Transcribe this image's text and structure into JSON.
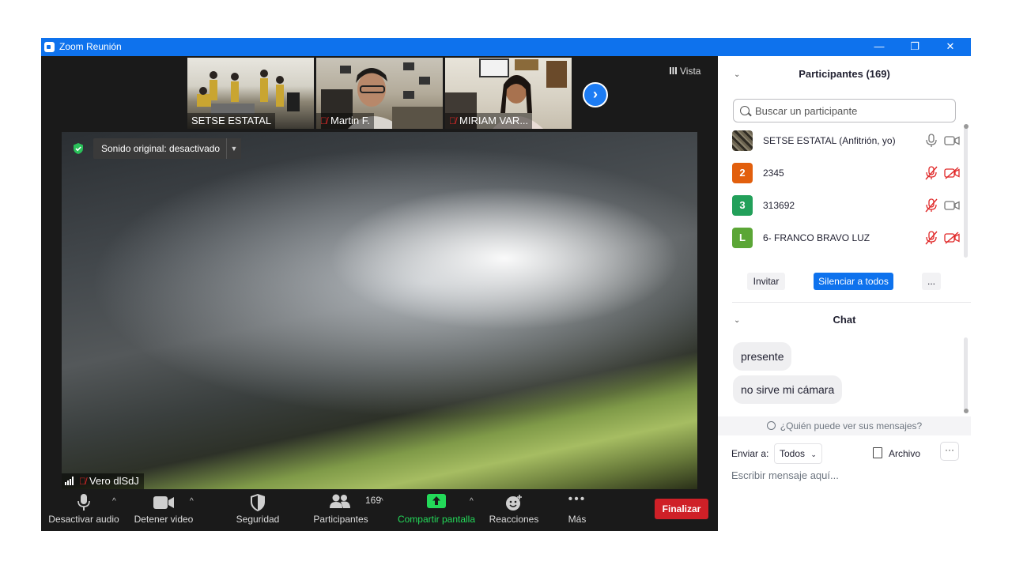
{
  "window": {
    "title": "Zoom Reunión",
    "controls": [
      "—",
      "❐",
      "✕"
    ]
  },
  "thumbnails": [
    {
      "name": "SETSE ESTATAL",
      "muted": false
    },
    {
      "name": "Martin F.",
      "muted": true
    },
    {
      "name": "MIRIAM VAR...",
      "muted": true
    }
  ],
  "view_button": "Vista",
  "main_video": {
    "original_sound": "Sonido original: desactivado",
    "speaker_label": "Vero dlSdJ",
    "speaker_muted": true
  },
  "toolbar": {
    "mute_audio": "Desactivar audio",
    "stop_video": "Detener video",
    "security": "Seguridad",
    "participants": "Participantes",
    "participants_count": "169",
    "share_screen": "Compartir pantalla",
    "reactions": "Reacciones",
    "more": "Más",
    "end": "Finalizar"
  },
  "participants_panel": {
    "title": "Participantes (169)",
    "search_placeholder": "Buscar un participante",
    "participants": [
      {
        "avatar": "",
        "name": "SETSE ESTATAL (Anfitrión, yo)",
        "avatar_color": "photo",
        "muted": false,
        "video_off": false
      },
      {
        "avatar": "2",
        "name": "2345",
        "avatar_color": "#e25f0d",
        "muted": true,
        "video_off": true
      },
      {
        "avatar": "3",
        "name": "313692",
        "avatar_color": "#22a05a",
        "muted": true,
        "video_off": false
      },
      {
        "avatar": "L",
        "name": "6- FRANCO BRAVO LUZ",
        "avatar_color": "#5ba636",
        "muted": true,
        "video_off": true
      }
    ],
    "invite": "Invitar",
    "mute_all": "Silenciar a todos",
    "more": "..."
  },
  "chat_panel": {
    "title": "Chat",
    "messages": [
      "presente",
      "no sirve mi cámara"
    ],
    "who_can_see": "¿Quién puede ver sus mensajes?",
    "send_to_label": "Enviar a:",
    "send_to_value": "Todos",
    "file_label": "Archivo",
    "input_placeholder": "Escribir mensaje aquí..."
  },
  "colors": {
    "titlebar": "#0e72ed",
    "meeting_bg": "#1a1a1a",
    "accent_blue": "#0e72ed",
    "end_red": "#cf2027",
    "share_green": "#23d959",
    "muted_red": "#e02828"
  }
}
